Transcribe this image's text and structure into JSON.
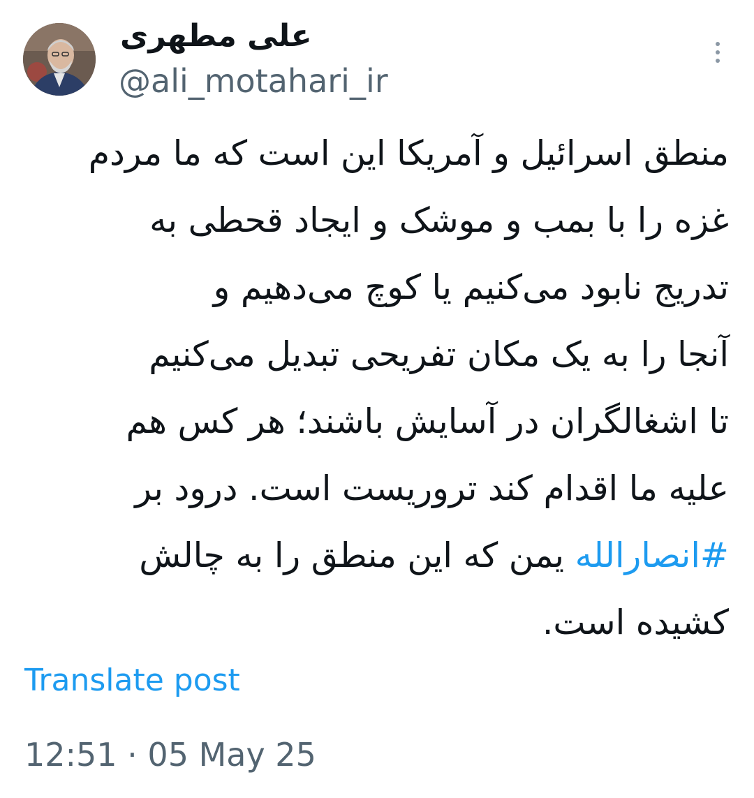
{
  "author": {
    "display_name": "علی مطهری",
    "handle": "@ali_motahari_ir",
    "avatar_icon": "profile-photo"
  },
  "more_icon": "more-vertical-icon",
  "tweet": {
    "lines": [
      "منطق اسرائیل و آمریکا این است که ما مردم",
      "غزه را با بمب و موشک و ایجاد قحطی به",
      "تدریج نابود می‌کنیم یا کوچ می‌دهیم و",
      "آنجا را به یک مکان تفریحی تبدیل می‌کنیم",
      "تا اشغالگران در آسایش باشند؛ هر کس هم",
      "علیه ما اقدام کند تروریست است. درود بر"
    ],
    "hashtag": "#انصارالله",
    "line7_rest": " یمن که این منطق را به چالش",
    "last_line": "کشیده است."
  },
  "translate_label": "Translate post",
  "timestamp": "12:51 · 05 May 25",
  "colors": {
    "link": "#1d9bf0",
    "text": "#0f1419",
    "secondary": "#536471"
  }
}
